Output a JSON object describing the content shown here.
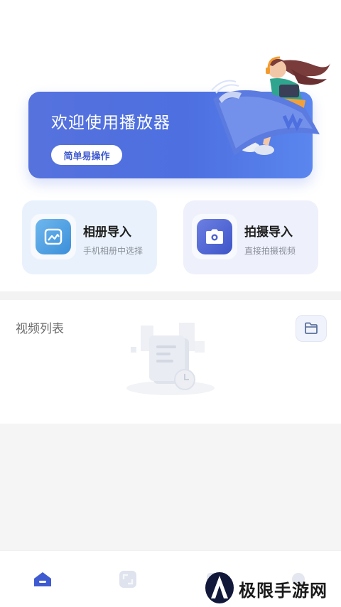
{
  "banner": {
    "title": "欢迎使用播放器",
    "button_label": "简单易操作"
  },
  "import_cards": {
    "album": {
      "title": "相册导入",
      "subtitle": "手机相册中选择",
      "icon": "image-icon"
    },
    "shoot": {
      "title": "拍摄导入",
      "subtitle": "直接拍摄视频",
      "icon": "camera-icon"
    }
  },
  "video_list": {
    "title": "视频列表",
    "folder_icon": "folder-icon",
    "empty_icon": "empty-document-icon"
  },
  "tabbar": {
    "items": [
      {
        "icon": "home-icon",
        "active": true
      },
      {
        "icon": "crop-icon",
        "active": false
      },
      {
        "icon": "tab-icon-3",
        "active": false
      },
      {
        "icon": "tab-icon-4",
        "active": false
      }
    ]
  },
  "watermark": {
    "text": "极限手游网"
  },
  "colors": {
    "accent": "#4d6fe0",
    "album_tile": "#3b8fd9",
    "shoot_tile": "#3e55c8",
    "card_album_bg": "#e9f2fc",
    "card_shoot_bg": "#eef0fb"
  }
}
